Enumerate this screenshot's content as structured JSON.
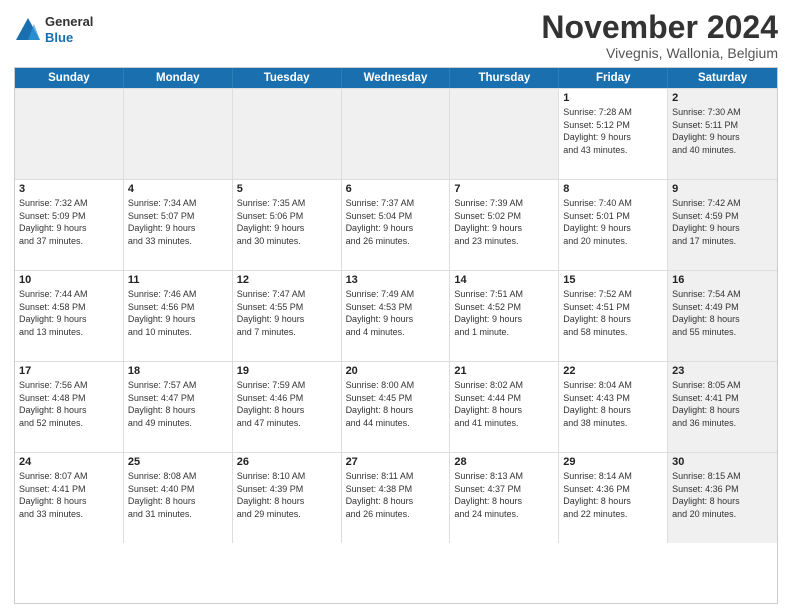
{
  "header": {
    "logo_general": "General",
    "logo_blue": "Blue",
    "month_title": "November 2024",
    "location": "Vivegnis, Wallonia, Belgium"
  },
  "weekdays": [
    "Sunday",
    "Monday",
    "Tuesday",
    "Wednesday",
    "Thursday",
    "Friday",
    "Saturday"
  ],
  "rows": [
    [
      {
        "day": "",
        "info": "",
        "shaded": true
      },
      {
        "day": "",
        "info": "",
        "shaded": true
      },
      {
        "day": "",
        "info": "",
        "shaded": true
      },
      {
        "day": "",
        "info": "",
        "shaded": true
      },
      {
        "day": "",
        "info": "",
        "shaded": true
      },
      {
        "day": "1",
        "info": "Sunrise: 7:28 AM\nSunset: 5:12 PM\nDaylight: 9 hours\nand 43 minutes.",
        "shaded": false
      },
      {
        "day": "2",
        "info": "Sunrise: 7:30 AM\nSunset: 5:11 PM\nDaylight: 9 hours\nand 40 minutes.",
        "shaded": true
      }
    ],
    [
      {
        "day": "3",
        "info": "Sunrise: 7:32 AM\nSunset: 5:09 PM\nDaylight: 9 hours\nand 37 minutes.",
        "shaded": false
      },
      {
        "day": "4",
        "info": "Sunrise: 7:34 AM\nSunset: 5:07 PM\nDaylight: 9 hours\nand 33 minutes.",
        "shaded": false
      },
      {
        "day": "5",
        "info": "Sunrise: 7:35 AM\nSunset: 5:06 PM\nDaylight: 9 hours\nand 30 minutes.",
        "shaded": false
      },
      {
        "day": "6",
        "info": "Sunrise: 7:37 AM\nSunset: 5:04 PM\nDaylight: 9 hours\nand 26 minutes.",
        "shaded": false
      },
      {
        "day": "7",
        "info": "Sunrise: 7:39 AM\nSunset: 5:02 PM\nDaylight: 9 hours\nand 23 minutes.",
        "shaded": false
      },
      {
        "day": "8",
        "info": "Sunrise: 7:40 AM\nSunset: 5:01 PM\nDaylight: 9 hours\nand 20 minutes.",
        "shaded": false
      },
      {
        "day": "9",
        "info": "Sunrise: 7:42 AM\nSunset: 4:59 PM\nDaylight: 9 hours\nand 17 minutes.",
        "shaded": true
      }
    ],
    [
      {
        "day": "10",
        "info": "Sunrise: 7:44 AM\nSunset: 4:58 PM\nDaylight: 9 hours\nand 13 minutes.",
        "shaded": false
      },
      {
        "day": "11",
        "info": "Sunrise: 7:46 AM\nSunset: 4:56 PM\nDaylight: 9 hours\nand 10 minutes.",
        "shaded": false
      },
      {
        "day": "12",
        "info": "Sunrise: 7:47 AM\nSunset: 4:55 PM\nDaylight: 9 hours\nand 7 minutes.",
        "shaded": false
      },
      {
        "day": "13",
        "info": "Sunrise: 7:49 AM\nSunset: 4:53 PM\nDaylight: 9 hours\nand 4 minutes.",
        "shaded": false
      },
      {
        "day": "14",
        "info": "Sunrise: 7:51 AM\nSunset: 4:52 PM\nDaylight: 9 hours\nand 1 minute.",
        "shaded": false
      },
      {
        "day": "15",
        "info": "Sunrise: 7:52 AM\nSunset: 4:51 PM\nDaylight: 8 hours\nand 58 minutes.",
        "shaded": false
      },
      {
        "day": "16",
        "info": "Sunrise: 7:54 AM\nSunset: 4:49 PM\nDaylight: 8 hours\nand 55 minutes.",
        "shaded": true
      }
    ],
    [
      {
        "day": "17",
        "info": "Sunrise: 7:56 AM\nSunset: 4:48 PM\nDaylight: 8 hours\nand 52 minutes.",
        "shaded": false
      },
      {
        "day": "18",
        "info": "Sunrise: 7:57 AM\nSunset: 4:47 PM\nDaylight: 8 hours\nand 49 minutes.",
        "shaded": false
      },
      {
        "day": "19",
        "info": "Sunrise: 7:59 AM\nSunset: 4:46 PM\nDaylight: 8 hours\nand 47 minutes.",
        "shaded": false
      },
      {
        "day": "20",
        "info": "Sunrise: 8:00 AM\nSunset: 4:45 PM\nDaylight: 8 hours\nand 44 minutes.",
        "shaded": false
      },
      {
        "day": "21",
        "info": "Sunrise: 8:02 AM\nSunset: 4:44 PM\nDaylight: 8 hours\nand 41 minutes.",
        "shaded": false
      },
      {
        "day": "22",
        "info": "Sunrise: 8:04 AM\nSunset: 4:43 PM\nDaylight: 8 hours\nand 38 minutes.",
        "shaded": false
      },
      {
        "day": "23",
        "info": "Sunrise: 8:05 AM\nSunset: 4:41 PM\nDaylight: 8 hours\nand 36 minutes.",
        "shaded": true
      }
    ],
    [
      {
        "day": "24",
        "info": "Sunrise: 8:07 AM\nSunset: 4:41 PM\nDaylight: 8 hours\nand 33 minutes.",
        "shaded": false
      },
      {
        "day": "25",
        "info": "Sunrise: 8:08 AM\nSunset: 4:40 PM\nDaylight: 8 hours\nand 31 minutes.",
        "shaded": false
      },
      {
        "day": "26",
        "info": "Sunrise: 8:10 AM\nSunset: 4:39 PM\nDaylight: 8 hours\nand 29 minutes.",
        "shaded": false
      },
      {
        "day": "27",
        "info": "Sunrise: 8:11 AM\nSunset: 4:38 PM\nDaylight: 8 hours\nand 26 minutes.",
        "shaded": false
      },
      {
        "day": "28",
        "info": "Sunrise: 8:13 AM\nSunset: 4:37 PM\nDaylight: 8 hours\nand 24 minutes.",
        "shaded": false
      },
      {
        "day": "29",
        "info": "Sunrise: 8:14 AM\nSunset: 4:36 PM\nDaylight: 8 hours\nand 22 minutes.",
        "shaded": false
      },
      {
        "day": "30",
        "info": "Sunrise: 8:15 AM\nSunset: 4:36 PM\nDaylight: 8 hours\nand 20 minutes.",
        "shaded": true
      }
    ]
  ]
}
